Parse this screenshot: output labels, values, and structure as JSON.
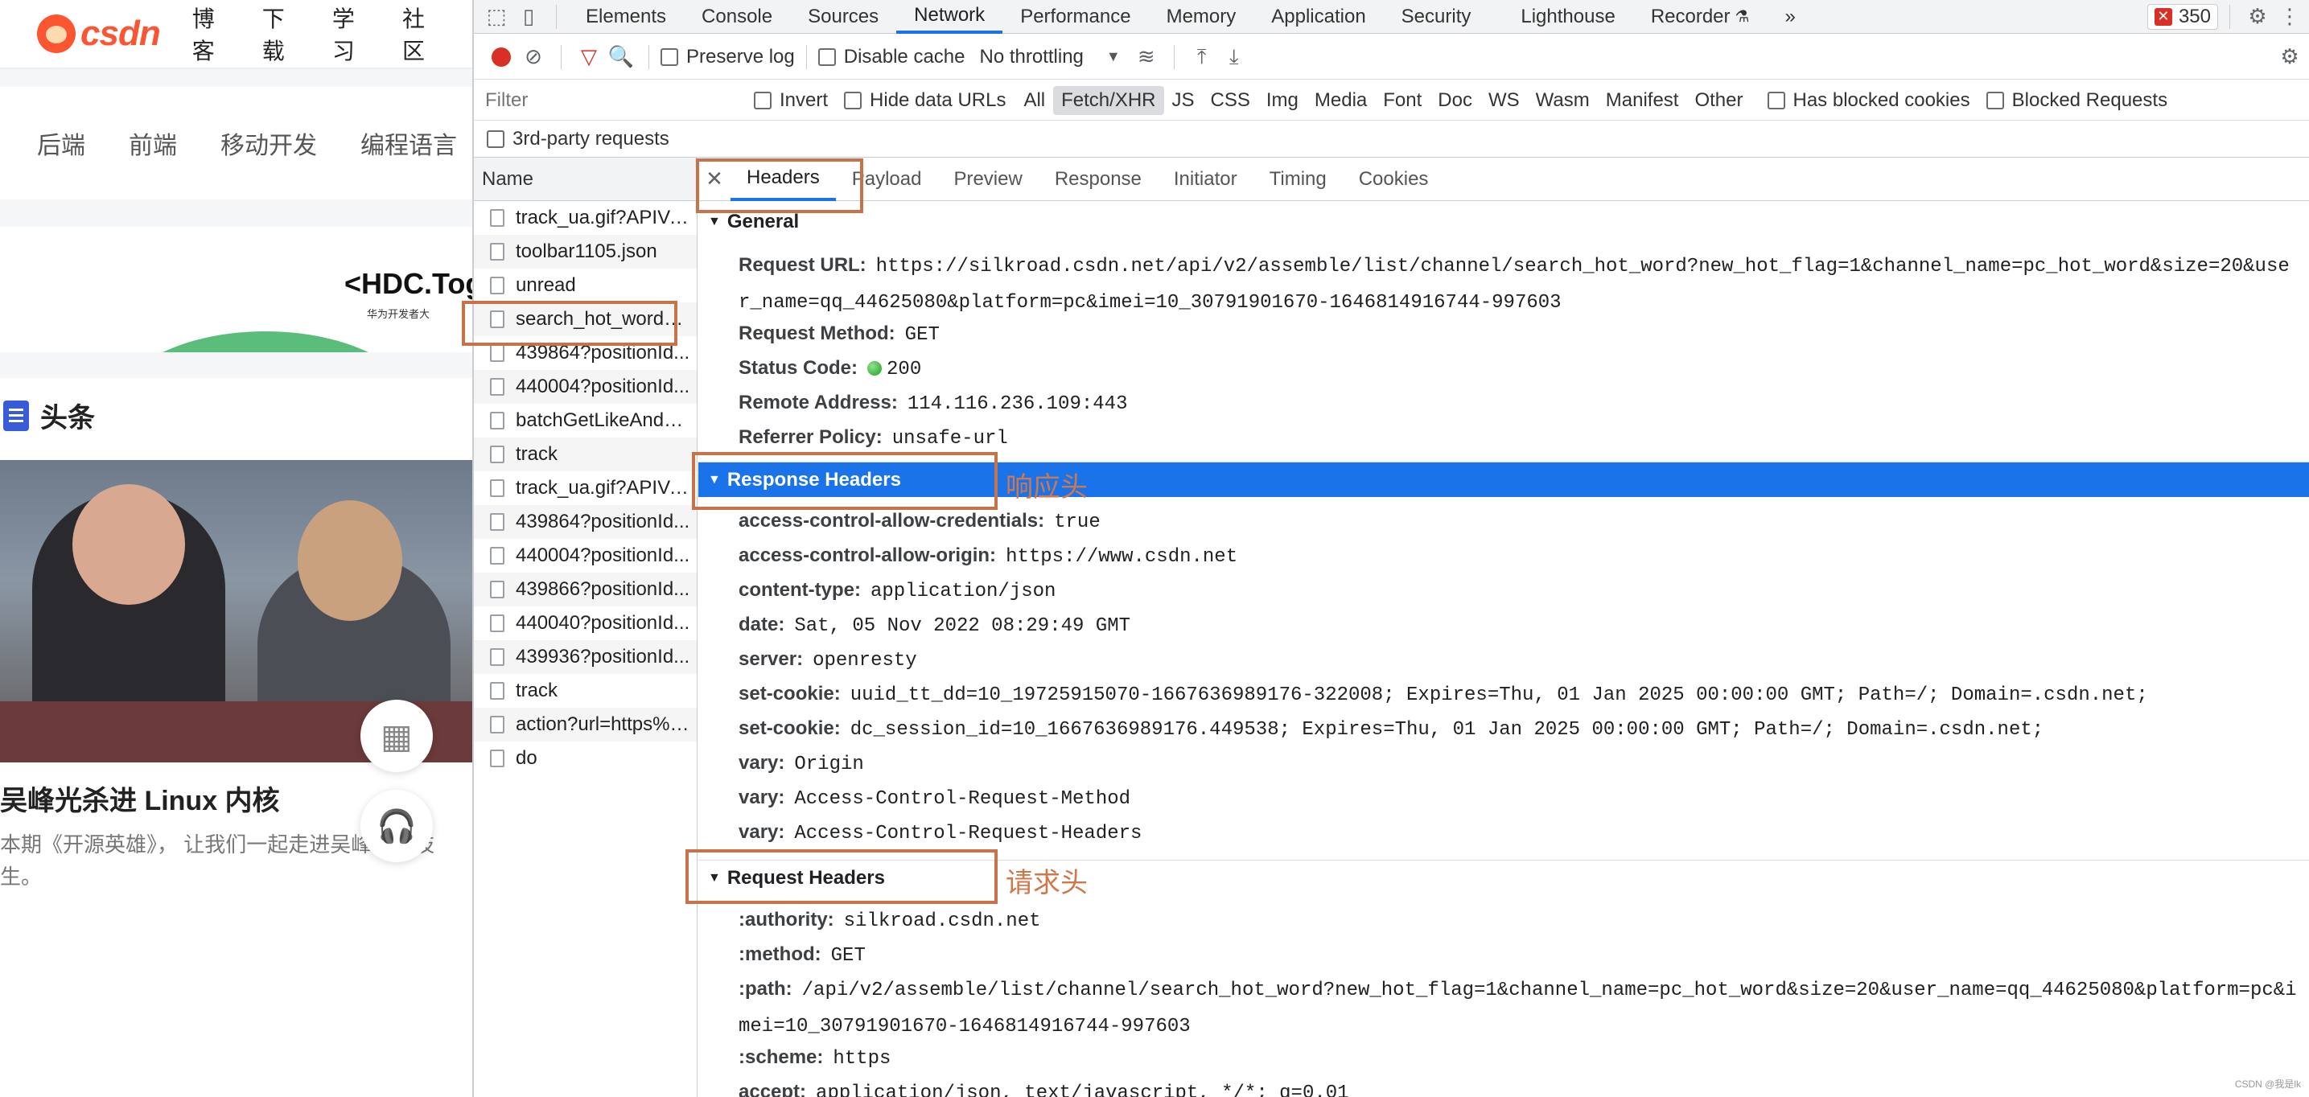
{
  "left_page": {
    "logo_text": "csdn",
    "top_nav": [
      "博客",
      "下载",
      "学习",
      "社区"
    ],
    "categories": [
      "后端",
      "前端",
      "移动开发",
      "编程语言"
    ],
    "banner": {
      "brand": "<HDC.Tog",
      "sub": "华为开发者大"
    },
    "section_title": "头条",
    "article_title": "吴峰光杀进 Linux 内核",
    "article_desc": "本期《开源英雄》， 让我们一起走进吴峰光的技\n生。"
  },
  "devtools": {
    "tabs": [
      "Elements",
      "Console",
      "Sources",
      "Network",
      "Performance",
      "Memory",
      "Application",
      "Security",
      "Lighthouse",
      "Recorder"
    ],
    "more_tabs": "»",
    "error_count": "350",
    "toolbar": {
      "preserve_log": "Preserve log",
      "disable_cache": "Disable cache",
      "throttling": "No throttling"
    },
    "filter": {
      "placeholder": "Filter",
      "invert": "Invert",
      "hide_data_urls": "Hide data URLs",
      "types": [
        "All",
        "Fetch/XHR",
        "JS",
        "CSS",
        "Img",
        "Media",
        "Font",
        "Doc",
        "WS",
        "Wasm",
        "Manifest",
        "Other"
      ],
      "has_blocked_cookies": "Has blocked cookies",
      "blocked_requests": "Blocked Requests",
      "third_party": "3rd-party requests"
    },
    "request_list": {
      "header": "Name",
      "rows": [
        "track_ua.gif?APIVersi...",
        "toolbar1105.json",
        "unread",
        "search_hot_word?n...",
        "439864?positionId...",
        "440004?positionId...",
        "batchGetLikeAndFa...",
        "track",
        "track_ua.gif?APIVersi...",
        "439864?positionId...",
        "440004?positionId...",
        "439866?positionId...",
        "440040?positionId...",
        "439936?positionId...",
        "track",
        "action?url=https%3...",
        "do"
      ]
    },
    "detail_tabs": [
      "Headers",
      "Payload",
      "Preview",
      "Response",
      "Initiator",
      "Timing",
      "Cookies"
    ],
    "general": {
      "title": "General",
      "request_url_k": "Request URL:",
      "request_url_v": "https://silkroad.csdn.net/api/v2/assemble/list/channel/search_hot_word?new_hot_flag=1&channel_name=pc_hot_word&size=20&user_name=qq_44625080&platform=pc&imei=10_30791901670-1646814916744-997603",
      "method_k": "Request Method:",
      "method_v": "GET",
      "status_k": "Status Code:",
      "status_v": "200",
      "remote_k": "Remote Address:",
      "remote_v": "114.116.236.109:443",
      "referrer_k": "Referrer Policy:",
      "referrer_v": "unsafe-url"
    },
    "response_headers": {
      "title": "Response Headers",
      "items": [
        {
          "k": "access-control-allow-credentials:",
          "v": "true"
        },
        {
          "k": "access-control-allow-origin:",
          "v": "https://www.csdn.net"
        },
        {
          "k": "content-type:",
          "v": "application/json"
        },
        {
          "k": "date:",
          "v": "Sat, 05 Nov 2022 08:29:49 GMT"
        },
        {
          "k": "server:",
          "v": "openresty"
        },
        {
          "k": "set-cookie:",
          "v": "uuid_tt_dd=10_19725915070-1667636989176-322008; Expires=Thu, 01 Jan 2025 00:00:00 GMT; Path=/; Domain=.csdn.net;"
        },
        {
          "k": "set-cookie:",
          "v": "dc_session_id=10_1667636989176.449538; Expires=Thu, 01 Jan 2025 00:00:00 GMT; Path=/; Domain=.csdn.net;"
        },
        {
          "k": "vary:",
          "v": "Origin"
        },
        {
          "k": "vary:",
          "v": "Access-Control-Request-Method"
        },
        {
          "k": "vary:",
          "v": "Access-Control-Request-Headers"
        }
      ]
    },
    "request_headers": {
      "title": "Request Headers",
      "authority_k": ":authority:",
      "authority_v": "silkroad.csdn.net",
      "method_k": ":method:",
      "method_v": "GET",
      "path_k": ":path:",
      "path_v": "/api/v2/assemble/list/channel/search_hot_word?new_hot_flag=1&channel_name=pc_hot_word&size=20&user_name=qq_44625080&platform=pc&imei=10_30791901670-1646814916744-997603",
      "scheme_k": ":scheme:",
      "scheme_v": "https",
      "accept_k": "accept:",
      "accept_v": "application/json, text/javascript, */*; q=0.01"
    }
  },
  "annotations": {
    "response_label": "响应头",
    "request_label": "请求头"
  },
  "watermark": "CSDN @我是lk",
  "colors": {
    "accent": "#1a73e8",
    "annotation": "#c8724a",
    "csdn_brand": "#fc5531"
  },
  "icons": [
    "inspect-icon",
    "device-toolbar-icon",
    "record-icon",
    "clear-icon",
    "filter-icon",
    "search-icon",
    "wifi-icon",
    "upload-icon",
    "download-icon",
    "gear-icon",
    "more-icon"
  ]
}
